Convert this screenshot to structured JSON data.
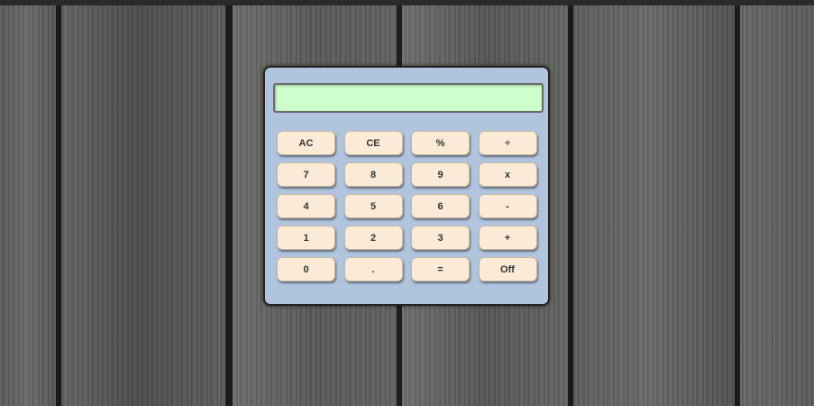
{
  "calculator": {
    "display_value": "",
    "keys": [
      {
        "label": "AC",
        "name": "all-clear-button"
      },
      {
        "label": "CE",
        "name": "clear-entry-button"
      },
      {
        "label": "%",
        "name": "percent-button"
      },
      {
        "label": "÷",
        "name": "divide-button"
      },
      {
        "label": "7",
        "name": "digit-7-button"
      },
      {
        "label": "8",
        "name": "digit-8-button"
      },
      {
        "label": "9",
        "name": "digit-9-button"
      },
      {
        "label": "x",
        "name": "multiply-button"
      },
      {
        "label": "4",
        "name": "digit-4-button"
      },
      {
        "label": "5",
        "name": "digit-5-button"
      },
      {
        "label": "6",
        "name": "digit-6-button"
      },
      {
        "label": "-",
        "name": "subtract-button"
      },
      {
        "label": "1",
        "name": "digit-1-button"
      },
      {
        "label": "2",
        "name": "digit-2-button"
      },
      {
        "label": "3",
        "name": "digit-3-button"
      },
      {
        "label": "+",
        "name": "add-button"
      },
      {
        "label": "0",
        "name": "digit-0-button"
      },
      {
        "label": ".",
        "name": "decimal-point-button"
      },
      {
        "label": "=",
        "name": "equals-button"
      },
      {
        "label": "Off",
        "name": "off-button"
      }
    ]
  },
  "colors": {
    "body": "#b0c4de",
    "display": "#ccffcc",
    "key": "#fbebd6"
  }
}
